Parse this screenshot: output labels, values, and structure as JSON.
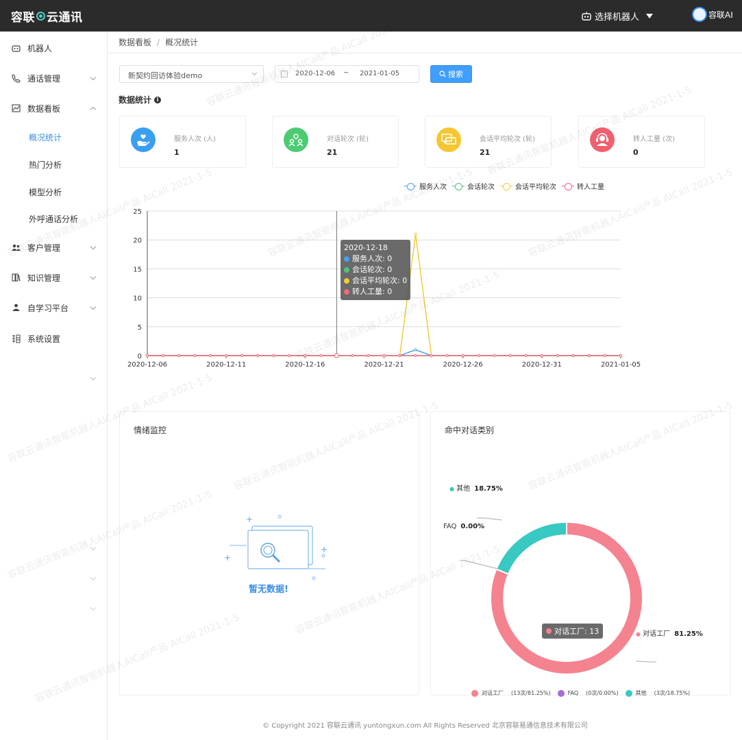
{
  "app": {
    "logo": "容联",
    "logo2": "云通讯",
    "robot_select": "选择机器人",
    "user": "容联AI"
  },
  "sidebar": {
    "items": [
      {
        "label": "机器人",
        "icon": "robot-icon"
      },
      {
        "label": "通话管理",
        "icon": "phone-icon"
      },
      {
        "label": "数据看板",
        "icon": "chart-icon"
      },
      {
        "label": "客户管理",
        "icon": "users-icon"
      },
      {
        "label": "知识管理",
        "icon": "book-icon"
      },
      {
        "label": "自学习平台",
        "icon": "learn-icon"
      },
      {
        "label": "系统设置",
        "icon": "settings-icon"
      }
    ],
    "sub": [
      "概况统计",
      "热门分析",
      "模型分析",
      "外呼通话分析"
    ]
  },
  "breadcrumb": {
    "root": "数据看板",
    "sep": "/",
    "current": "概况统计"
  },
  "filters": {
    "robot": "新契约回访体验demo",
    "date_start": "2020-12-06",
    "tilde": "~",
    "date_end": "2021-01-05",
    "search": "搜索"
  },
  "section_title": "数据统计",
  "cards": [
    {
      "label": "服务人次 (人)",
      "value": "1",
      "color": "#3a9ff0"
    },
    {
      "label": "对话轮次 (轮)",
      "value": "21",
      "color": "#4ccb73"
    },
    {
      "label": "会话平均轮次 (轮)",
      "value": "21",
      "color": "#f5c631"
    },
    {
      "label": "转人工量 (次)",
      "value": "0",
      "color": "#f0606e"
    }
  ],
  "chart_data": {
    "type": "line",
    "x": [
      "2020-12-06",
      "2020-12-07",
      "2020-12-08",
      "2020-12-09",
      "2020-12-10",
      "2020-12-11",
      "2020-12-12",
      "2020-12-13",
      "2020-12-14",
      "2020-12-15",
      "2020-12-16",
      "2020-12-17",
      "2020-12-18",
      "2020-12-19",
      "2020-12-20",
      "2020-12-21",
      "2020-12-22",
      "2020-12-23",
      "2020-12-24",
      "2020-12-25",
      "2020-12-26",
      "2020-12-27",
      "2020-12-28",
      "2020-12-29",
      "2020-12-30",
      "2020-12-31",
      "2021-01-01",
      "2021-01-02",
      "2021-01-03",
      "2021-01-04",
      "2021-01-05"
    ],
    "xticks": [
      "2020-12-06",
      "2020-12-11",
      "2020-12-16",
      "2020-12-21",
      "2020-12-26",
      "2020-12-31",
      "2021-01-05"
    ],
    "yticks": [
      "0",
      "5",
      "10",
      "15",
      "20",
      "25"
    ],
    "ylim": [
      0,
      25
    ],
    "series": [
      {
        "name": "服务人次",
        "color": "#4a9ff5",
        "values": [
          0,
          0,
          0,
          0,
          0,
          0,
          0,
          0,
          0,
          0,
          0,
          0,
          0,
          0,
          0,
          0,
          0,
          1,
          0,
          0,
          0,
          0,
          0,
          0,
          0,
          0,
          0,
          0,
          0,
          0,
          0
        ]
      },
      {
        "name": "会话轮次",
        "color": "#52c27a",
        "values": [
          0,
          0,
          0,
          0,
          0,
          0,
          0,
          0,
          0,
          0,
          0,
          0,
          0,
          0,
          0,
          0,
          0,
          0,
          0,
          0,
          0,
          0,
          0,
          0,
          0,
          0,
          0,
          0,
          0,
          0,
          0
        ]
      },
      {
        "name": "会话平均轮次",
        "color": "#f2cb3c",
        "values": [
          0,
          0,
          0,
          0,
          0,
          0,
          0,
          0,
          0,
          0,
          0,
          0,
          0,
          0,
          0,
          0,
          0,
          21,
          0,
          0,
          0,
          0,
          0,
          0,
          0,
          0,
          0,
          0,
          0,
          0,
          0
        ]
      },
      {
        "name": "转人工量",
        "color": "#ef6a7c",
        "values": [
          0,
          0,
          0,
          0,
          0,
          0,
          0,
          0,
          0,
          0,
          0,
          0,
          0,
          0,
          0,
          0,
          0,
          0,
          0,
          0,
          0,
          0,
          0,
          0,
          0,
          0,
          0,
          0,
          0,
          0,
          0
        ]
      }
    ],
    "tooltip": {
      "date": "2020-12-18",
      "rows": [
        "服务人次: 0",
        "会话轮次: 0",
        "会话平均轮次: 0",
        "转人工量: 0"
      ]
    }
  },
  "panels": {
    "emotion": {
      "title": "情绪监控",
      "empty": "暂无数据!"
    },
    "dialog": {
      "title": "命中对话类别"
    }
  },
  "pie_data": {
    "type": "pie",
    "slices": [
      {
        "name": "对话工厂",
        "value": 13,
        "pct": "81.25%",
        "legend": "(13次/81.25%)",
        "color": "#f5828f"
      },
      {
        "name": "FAQ",
        "value": 0,
        "pct": "0.00%",
        "legend": "(0次/0.00%)",
        "color": "#a86bd8"
      },
      {
        "name": "其他",
        "value": 3,
        "pct": "18.75%",
        "legend": "(3次/18.75%)",
        "color": "#38c9c3"
      }
    ],
    "tooltip": "对话工厂: 13"
  },
  "footer": "© Copyright 2021   容联云通讯   yuntongxun.com   All Rights Reserved  北京容联易通信息技术有限公司",
  "watermark": "容联云通讯智能机器人AICall产品  AICall  2021-1-5"
}
